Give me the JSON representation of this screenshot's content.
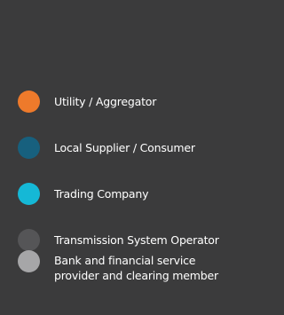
{
  "legend": {
    "items": [
      {
        "label": "Utility / Aggregator",
        "color": "#ee7a2b"
      },
      {
        "label": "Local Supplier / Consumer",
        "color": "#17607e"
      },
      {
        "label": "Trading Company",
        "color": "#15b8d6"
      },
      {
        "label": "Transmission System Operator",
        "color": "#555557"
      },
      {
        "label": "Bank and financial service provider and clearing member",
        "color": "#a6a6a8"
      }
    ]
  }
}
